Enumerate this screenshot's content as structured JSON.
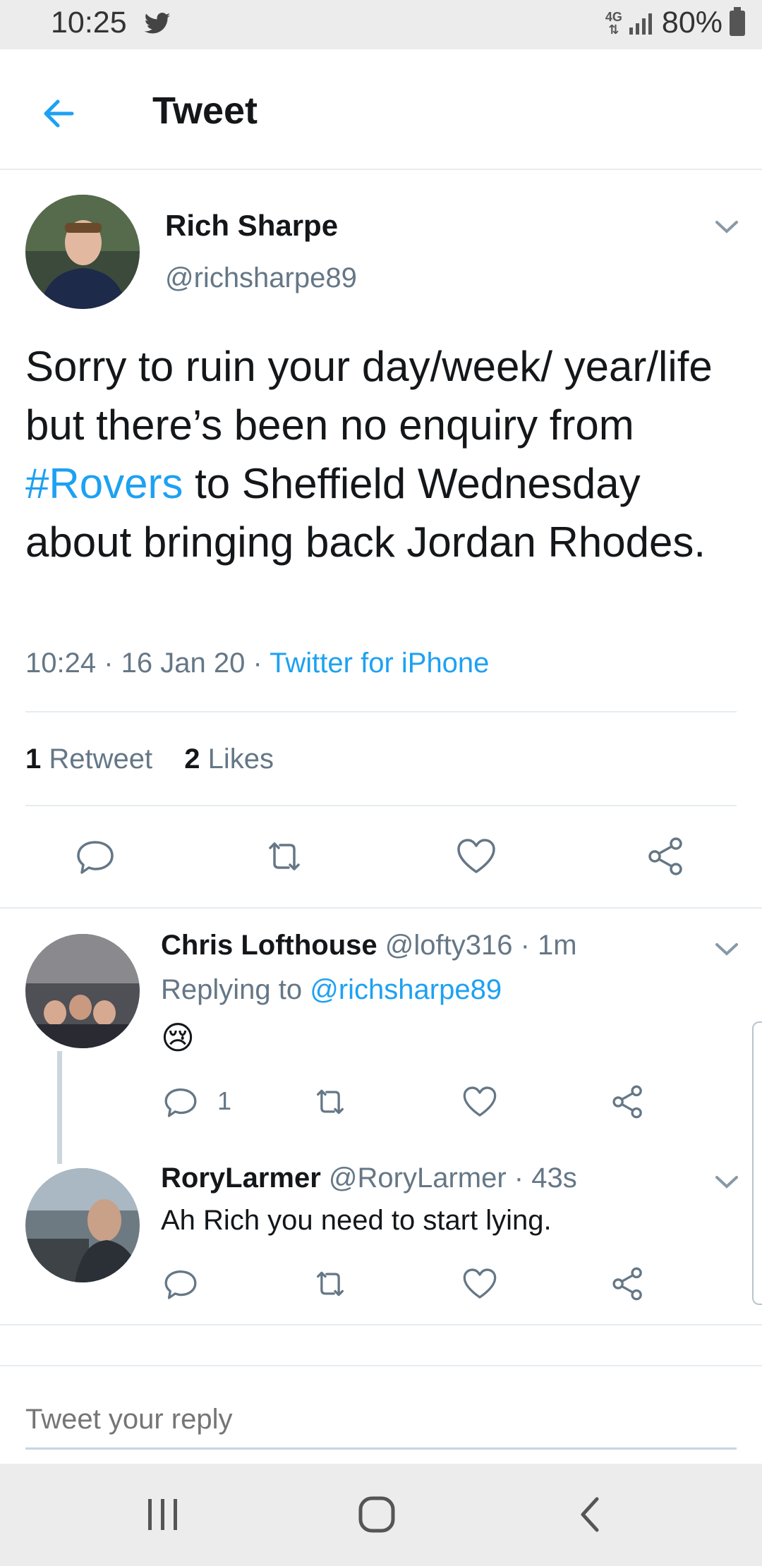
{
  "status_bar": {
    "time": "10:25",
    "network": "4G",
    "battery": "80%"
  },
  "header": {
    "title": "Tweet"
  },
  "main_tweet": {
    "author_name": "Rich Sharpe",
    "author_handle": "@richsharpe89",
    "text_before": "Sorry to ruin your day/week/ year/life but there’s been no enquiry from ",
    "hashtag": "#Rovers",
    "text_after": " to Sheffield Wednesday about bringing back Jordan Rhodes.",
    "timestamp": "10:24 · 16 Jan 20 · ",
    "source": "Twitter for iPhone",
    "retweet_count": "1",
    "retweet_label": "Retweet",
    "like_count": "2",
    "like_label": "Likes"
  },
  "replies": [
    {
      "name": "Chris Lofthouse",
      "handle": "@lofty316",
      "time": " · 1m",
      "replying_label": "Replying to ",
      "replying_to": "@richsharpe89",
      "text": "😢",
      "reply_count": "1"
    },
    {
      "name": "RoryLarmer",
      "handle": "@RoryLarmer",
      "time": " · 43s",
      "text": "Ah Rich you need to start lying."
    }
  ],
  "compose": {
    "placeholder": "Tweet your reply"
  },
  "colors": {
    "accent": "#1da1f2",
    "muted": "#657786",
    "text": "#14171a"
  }
}
